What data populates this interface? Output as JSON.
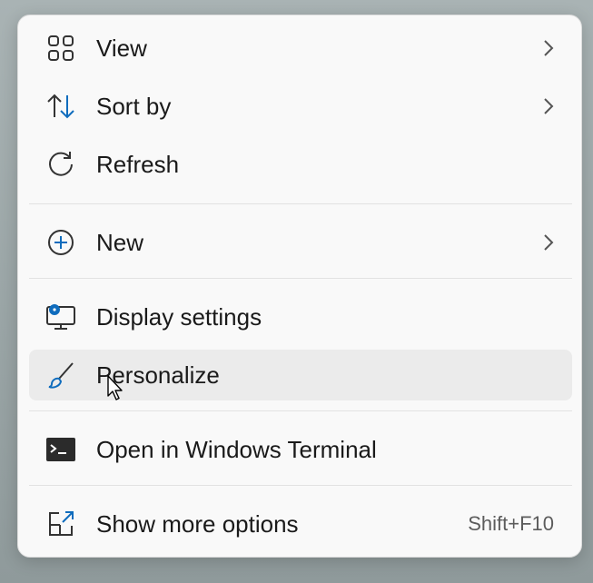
{
  "menu": {
    "items": [
      {
        "label": "View",
        "icon": "grid-icon",
        "submenu": true
      },
      {
        "label": "Sort by",
        "icon": "sort-arrows-icon",
        "submenu": true
      },
      {
        "label": "Refresh",
        "icon": "refresh-icon",
        "submenu": false
      },
      {
        "label": "New",
        "icon": "plus-circle-icon",
        "submenu": true
      },
      {
        "label": "Display settings",
        "icon": "display-settings-icon",
        "submenu": false
      },
      {
        "label": "Personalize",
        "icon": "brush-icon",
        "submenu": false,
        "hovered": true
      },
      {
        "label": "Open in Windows Terminal",
        "icon": "terminal-icon",
        "submenu": false
      },
      {
        "label": "Show more options",
        "icon": "show-more-options-icon",
        "submenu": false,
        "shortcut": "Shift+F10"
      }
    ]
  },
  "colors": {
    "accent": "#0f6cbd",
    "icon_stroke": "#333333",
    "menu_background": "#f9f9f9",
    "hover_background": "#ebebeb"
  }
}
